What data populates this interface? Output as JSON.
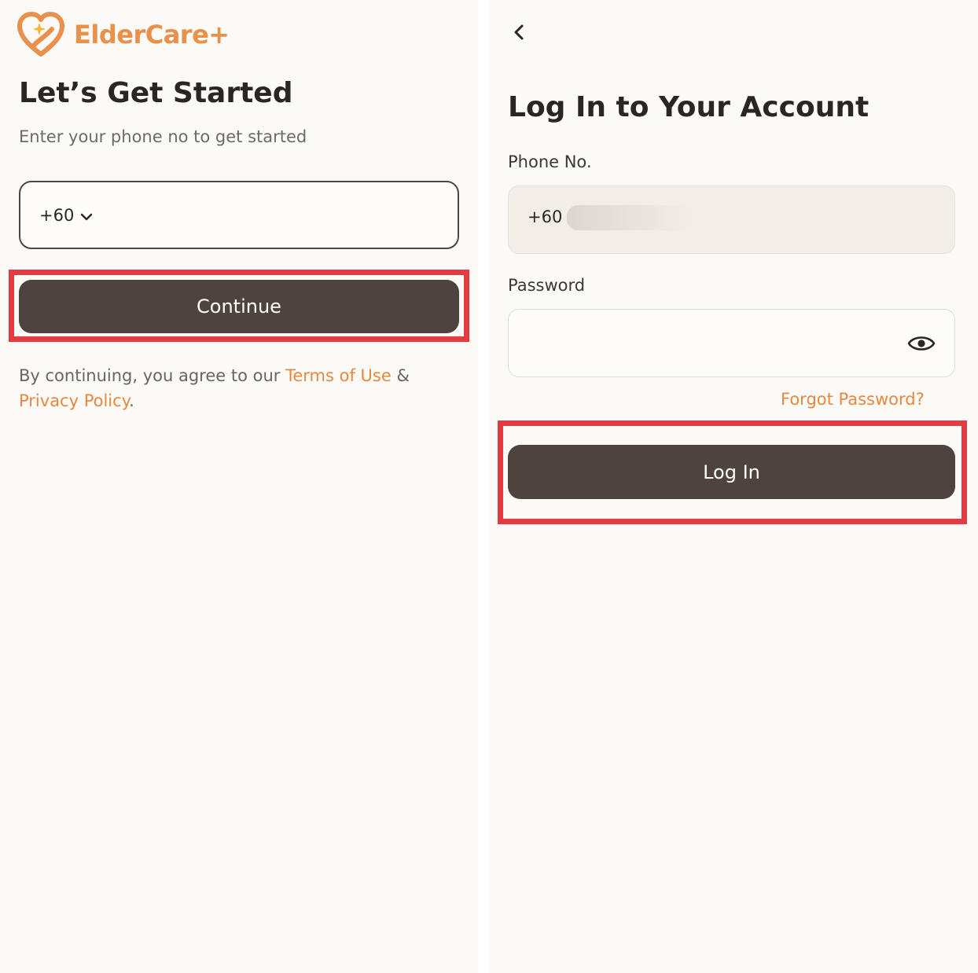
{
  "brand": {
    "name": "ElderCare+",
    "accent_color": "#e9904a"
  },
  "colors": {
    "primary_button": "#4f433d",
    "link": "#e8873f",
    "highlight": "#e43b43",
    "background": "#fbfaf6"
  },
  "get_started": {
    "title": "Let’s Get Started",
    "subtitle": "Enter your phone no to get started",
    "country_code": "+60",
    "country_icon": "chevron-down-icon",
    "continue_label": "Continue",
    "terms_prefix": "By continuing, you agree to our ",
    "terms_link": "Terms of Use",
    "terms_join": " &",
    "privacy_link": "Privacy Policy",
    "terms_suffix": "."
  },
  "login": {
    "back_icon": "chevron-left-icon",
    "title": "Log In to Your Account",
    "phone_label": "Phone No.",
    "phone_value": "+60",
    "password_label": "Password",
    "password_value": "",
    "password_icon": "eye-icon",
    "forgot_label": "Forgot Password?",
    "login_label": "Log In"
  }
}
